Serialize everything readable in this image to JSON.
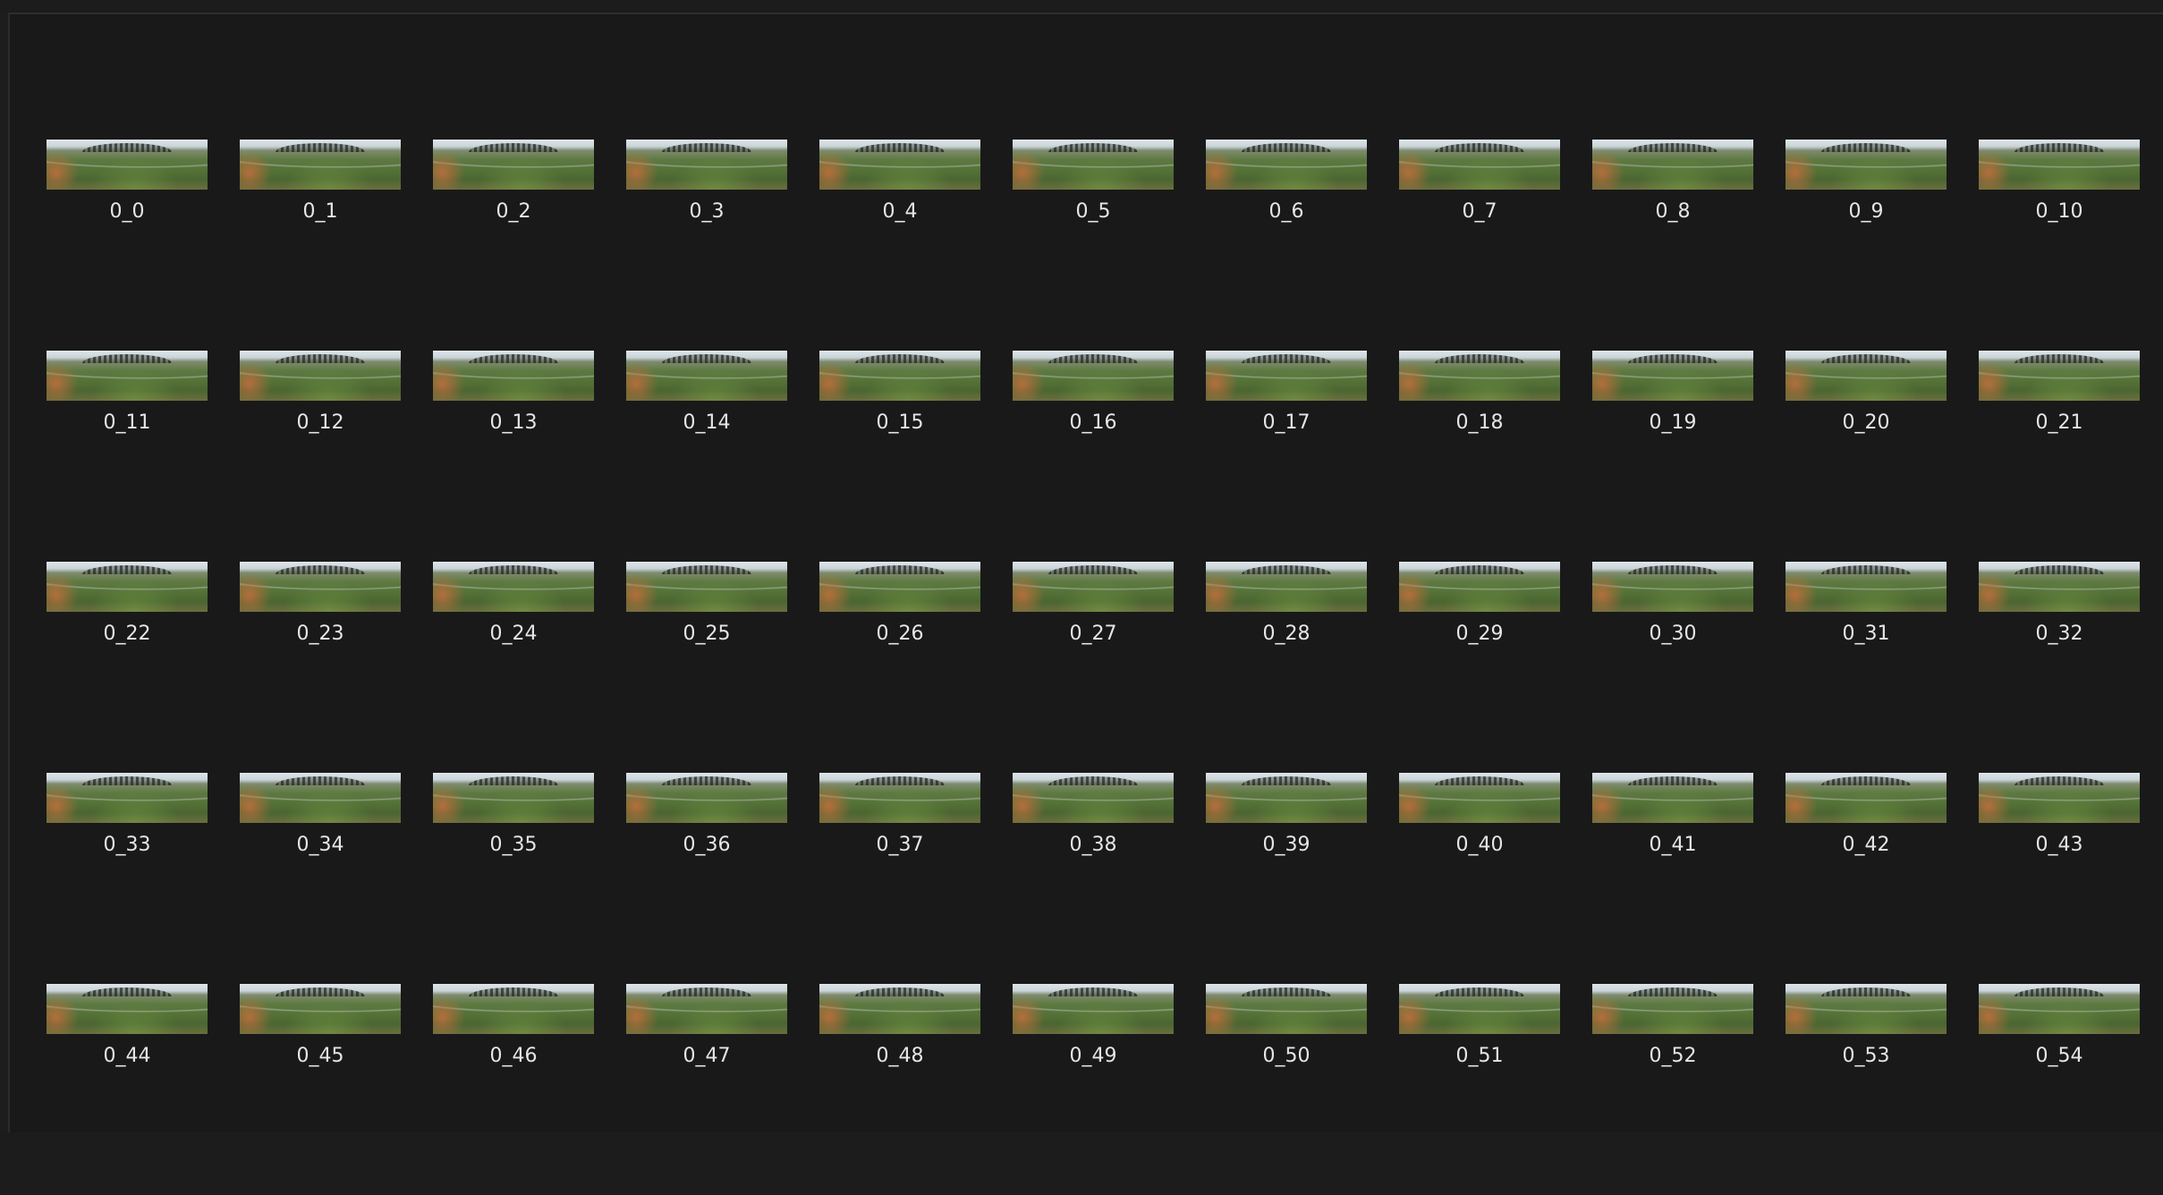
{
  "thumbnails": {
    "labels": [
      "0_0",
      "0_1",
      "0_2",
      "0_3",
      "0_4",
      "0_5",
      "0_6",
      "0_7",
      "0_8",
      "0_9",
      "0_10",
      "0_11",
      "0_12",
      "0_13",
      "0_14",
      "0_15",
      "0_16",
      "0_17",
      "0_18",
      "0_19",
      "0_20",
      "0_21",
      "0_22",
      "0_23",
      "0_24",
      "0_25",
      "0_26",
      "0_27",
      "0_28",
      "0_29",
      "0_30",
      "0_31",
      "0_32",
      "0_33",
      "0_34",
      "0_35",
      "0_36",
      "0_37",
      "0_38",
      "0_39",
      "0_40",
      "0_41",
      "0_42",
      "0_43",
      "0_44",
      "0_45",
      "0_46",
      "0_47",
      "0_48",
      "0_49",
      "0_50",
      "0_51",
      "0_52",
      "0_53",
      "0_54"
    ]
  },
  "colors": {
    "background": "#191919",
    "label_text": "#e6e6e6"
  },
  "icons": {
    "thumbnail": "landscape-image-icon"
  }
}
